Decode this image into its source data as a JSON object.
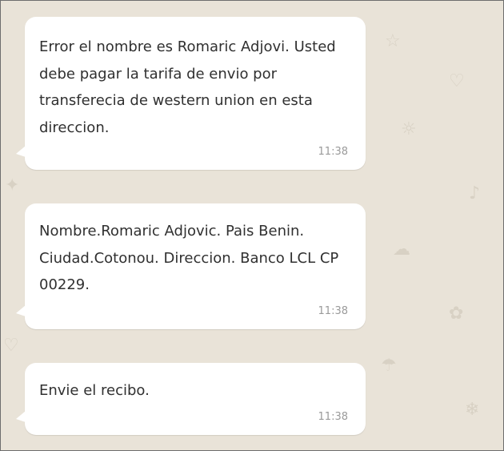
{
  "chat": {
    "messages": [
      {
        "text": "Error el nombre es Romaric Adjovi. Usted debe pagar la tarifa de envio por transferecia de western union en esta direccion.",
        "time": "11:38"
      },
      {
        "text": "Nombre.Romaric Adjovic. Pais Benin. Ciudad.Cotonou. Direccion. Banco LCL CP 00229.",
        "time": "11:38"
      },
      {
        "text": "Envie el recibo.",
        "time": "11:38"
      }
    ]
  },
  "colors": {
    "background": "#e9e3d8",
    "bubble": "#ffffff",
    "text": "#303030",
    "timestamp": "#9a9a9a"
  }
}
